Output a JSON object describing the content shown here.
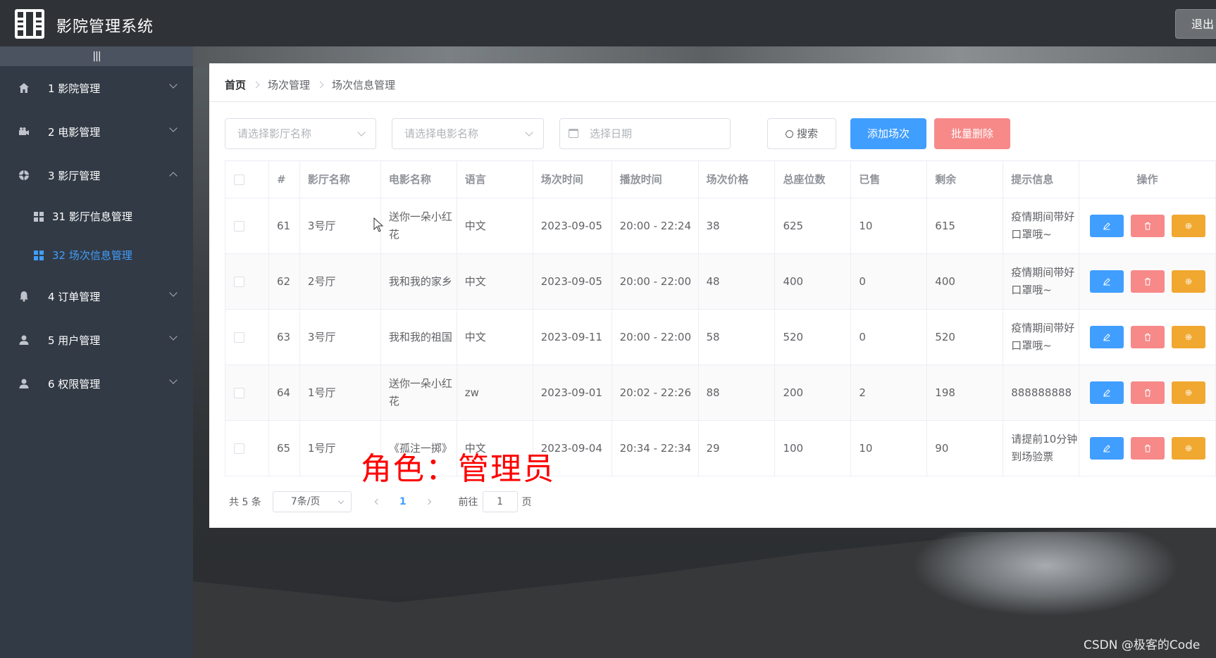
{
  "header": {
    "title": "影院管理系统",
    "logout_label": "退出"
  },
  "sidebar": {
    "collapse_label": "|||",
    "items": [
      {
        "label": "1 影院管理",
        "icon": "home-icon",
        "expanded": false
      },
      {
        "label": "2 电影管理",
        "icon": "camera-icon",
        "expanded": false
      },
      {
        "label": "3 影厅管理",
        "icon": "aperture-icon",
        "expanded": true,
        "children": [
          {
            "label": "31 影厅信息管理",
            "active": false
          },
          {
            "label": "32 场次信息管理",
            "active": true
          }
        ]
      },
      {
        "label": "4 订单管理",
        "icon": "bell-icon",
        "expanded": false
      },
      {
        "label": "5 用户管理",
        "icon": "user-icon",
        "expanded": false
      },
      {
        "label": "6 权限管理",
        "icon": "user-icon",
        "expanded": false
      }
    ]
  },
  "breadcrumb": [
    "首页",
    "场次管理",
    "场次信息管理"
  ],
  "filters": {
    "cinema_placeholder": "请选择影厅名称",
    "movie_placeholder": "请选择电影名称",
    "date_placeholder": "选择日期",
    "search_label": "搜索",
    "add_label": "添加场次",
    "batch_delete_label": "批量删除"
  },
  "table": {
    "columns": [
      "#",
      "影厅名称",
      "电影名称",
      "语言",
      "场次时间",
      "播放时间",
      "场次价格",
      "总座位数",
      "已售",
      "剩余",
      "提示信息",
      "操作"
    ],
    "rows": [
      {
        "id": "61",
        "hall": "3号厅",
        "movie": "送你一朵小红花",
        "lang": "中文",
        "date": "2023-09-05",
        "time": "20:00 - 22:24",
        "price": "38",
        "seats": "625",
        "sold": "10",
        "left": "615",
        "tip": "疫情期间带好口罩哦~"
      },
      {
        "id": "62",
        "hall": "2号厅",
        "movie": "我和我的家乡",
        "lang": "中文",
        "date": "2023-09-05",
        "time": "20:00 - 22:00",
        "price": "48",
        "seats": "400",
        "sold": "0",
        "left": "400",
        "tip": "疫情期间带好口罩哦~"
      },
      {
        "id": "63",
        "hall": "3号厅",
        "movie": "我和我的祖国",
        "lang": "中文",
        "date": "2023-09-11",
        "time": "20:00 - 22:00",
        "price": "58",
        "seats": "520",
        "sold": "0",
        "left": "520",
        "tip": "疫情期间带好口罩哦~"
      },
      {
        "id": "64",
        "hall": "1号厅",
        "movie": "送你一朵小红花",
        "lang": "zw",
        "date": "2023-09-01",
        "time": "20:02 - 22:26",
        "price": "88",
        "seats": "200",
        "sold": "2",
        "left": "198",
        "tip": "888888888"
      },
      {
        "id": "65",
        "hall": "1号厅",
        "movie": "《孤注一掷》",
        "lang": "中文",
        "date": "2023-09-04",
        "time": "20:34 - 22:34",
        "price": "29",
        "seats": "100",
        "sold": "10",
        "left": "90",
        "tip": "请提前10分钟到场验票"
      }
    ]
  },
  "pagination": {
    "total_label": "共 5 条",
    "page_size": "7条/页",
    "current_page": "1",
    "goto_label": "前往",
    "goto_value": "1",
    "page_suffix": "页"
  },
  "overlay": {
    "caption": "角色：管理员",
    "watermark": "CSDN @极客的Code"
  },
  "colors": {
    "primary": "#409eff",
    "danger": "#f78989",
    "warning": "#f0a830",
    "sidebar_bg": "#323a45",
    "header_bg": "#2f3337"
  }
}
